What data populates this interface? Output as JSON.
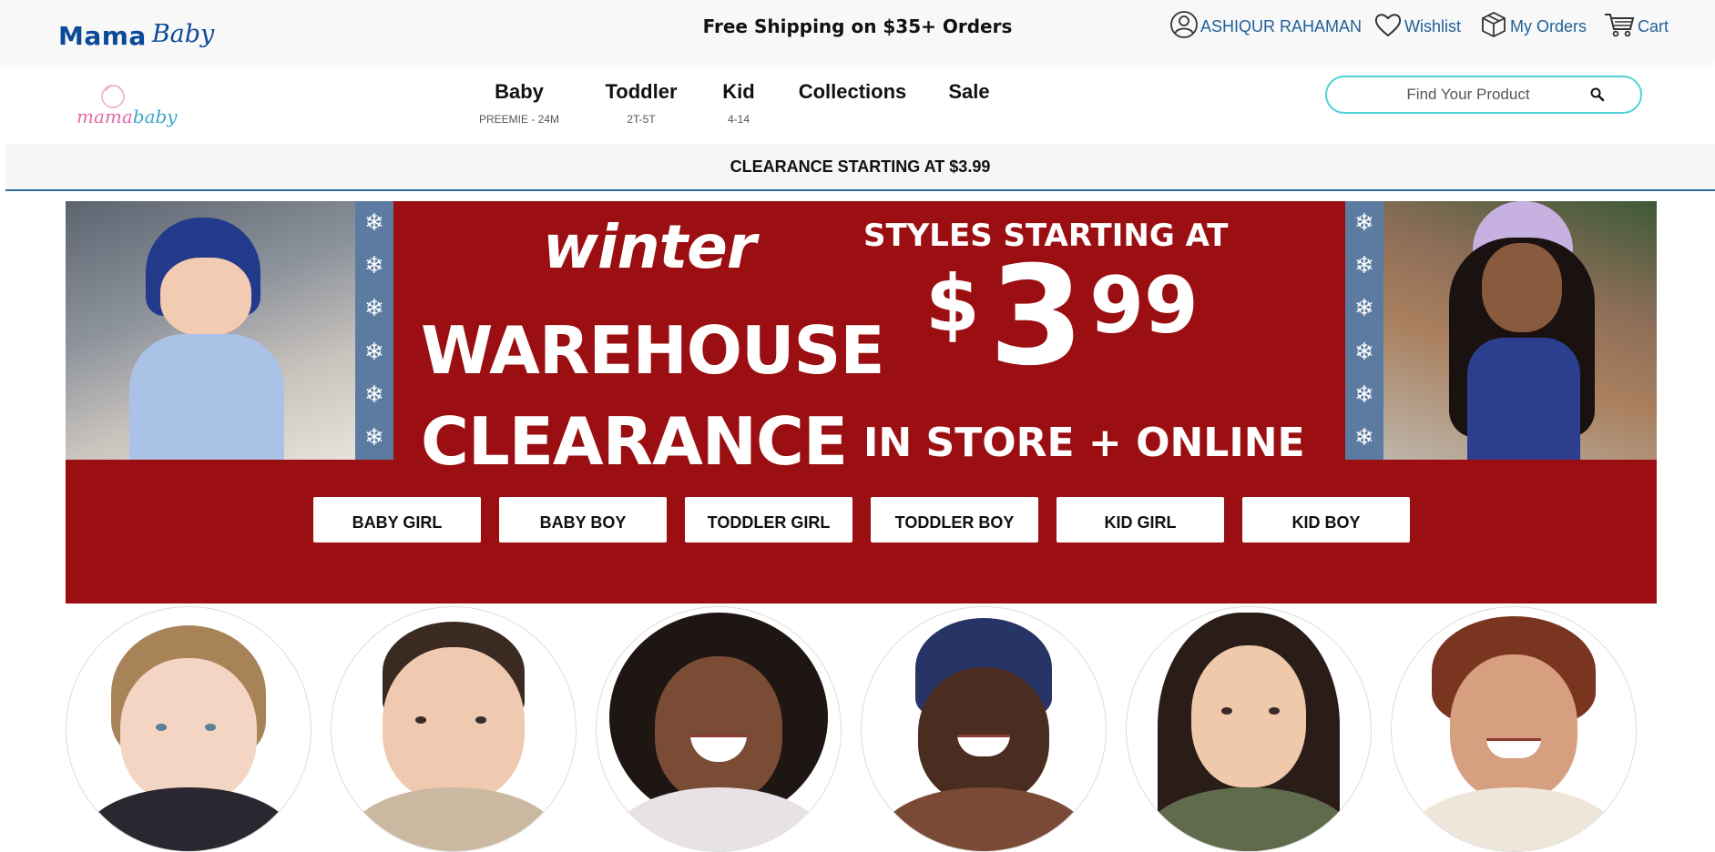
{
  "topbar": {
    "brand_mama": "Mama",
    "brand_baby": "Baby",
    "promo": "Free Shipping on $35+ Orders",
    "account_name": "ASHIQUR RAHAMAN",
    "wishlist": "Wishlist",
    "orders": "My Orders",
    "cart": "Cart"
  },
  "nav": {
    "logo_text": "mamababy",
    "items": [
      {
        "label": "Baby",
        "sub": "PREEMIE - 24M"
      },
      {
        "label": "Toddler",
        "sub": "2T-5T"
      },
      {
        "label": "Kid",
        "sub": "4-14"
      },
      {
        "label": "Collections",
        "sub": ""
      },
      {
        "label": "Sale",
        "sub": ""
      }
    ],
    "search_placeholder": "Find Your Product"
  },
  "clearance_strip": "CLEARANCE STARTING AT $3.99",
  "hero": {
    "winter": "winter",
    "line1": "WAREHOUSE",
    "line2": "CLEARANCE",
    "styles": "STYLES STARTING AT",
    "dollar": "$",
    "price_whole": "3",
    "price_cents": "99",
    "channel": "IN STORE + ONLINE",
    "categories": [
      "BABY GIRL",
      "BABY BOY",
      "TODDLER GIRL",
      "TODDLER BOY",
      "KID GIRL",
      "KID BOY"
    ]
  },
  "colors": {
    "brand_blue": "#0b4a99",
    "link_blue": "#1f5f99",
    "hero_red": "#9b0f12",
    "search_border": "#52d2d8",
    "snow_band": "#5c7ba0"
  },
  "icons": {
    "account": "user-circle-icon",
    "wishlist": "heart-icon",
    "orders": "box-icon",
    "cart": "cart-icon",
    "search": "search-icon",
    "snowflake": "snowflake-icon"
  }
}
